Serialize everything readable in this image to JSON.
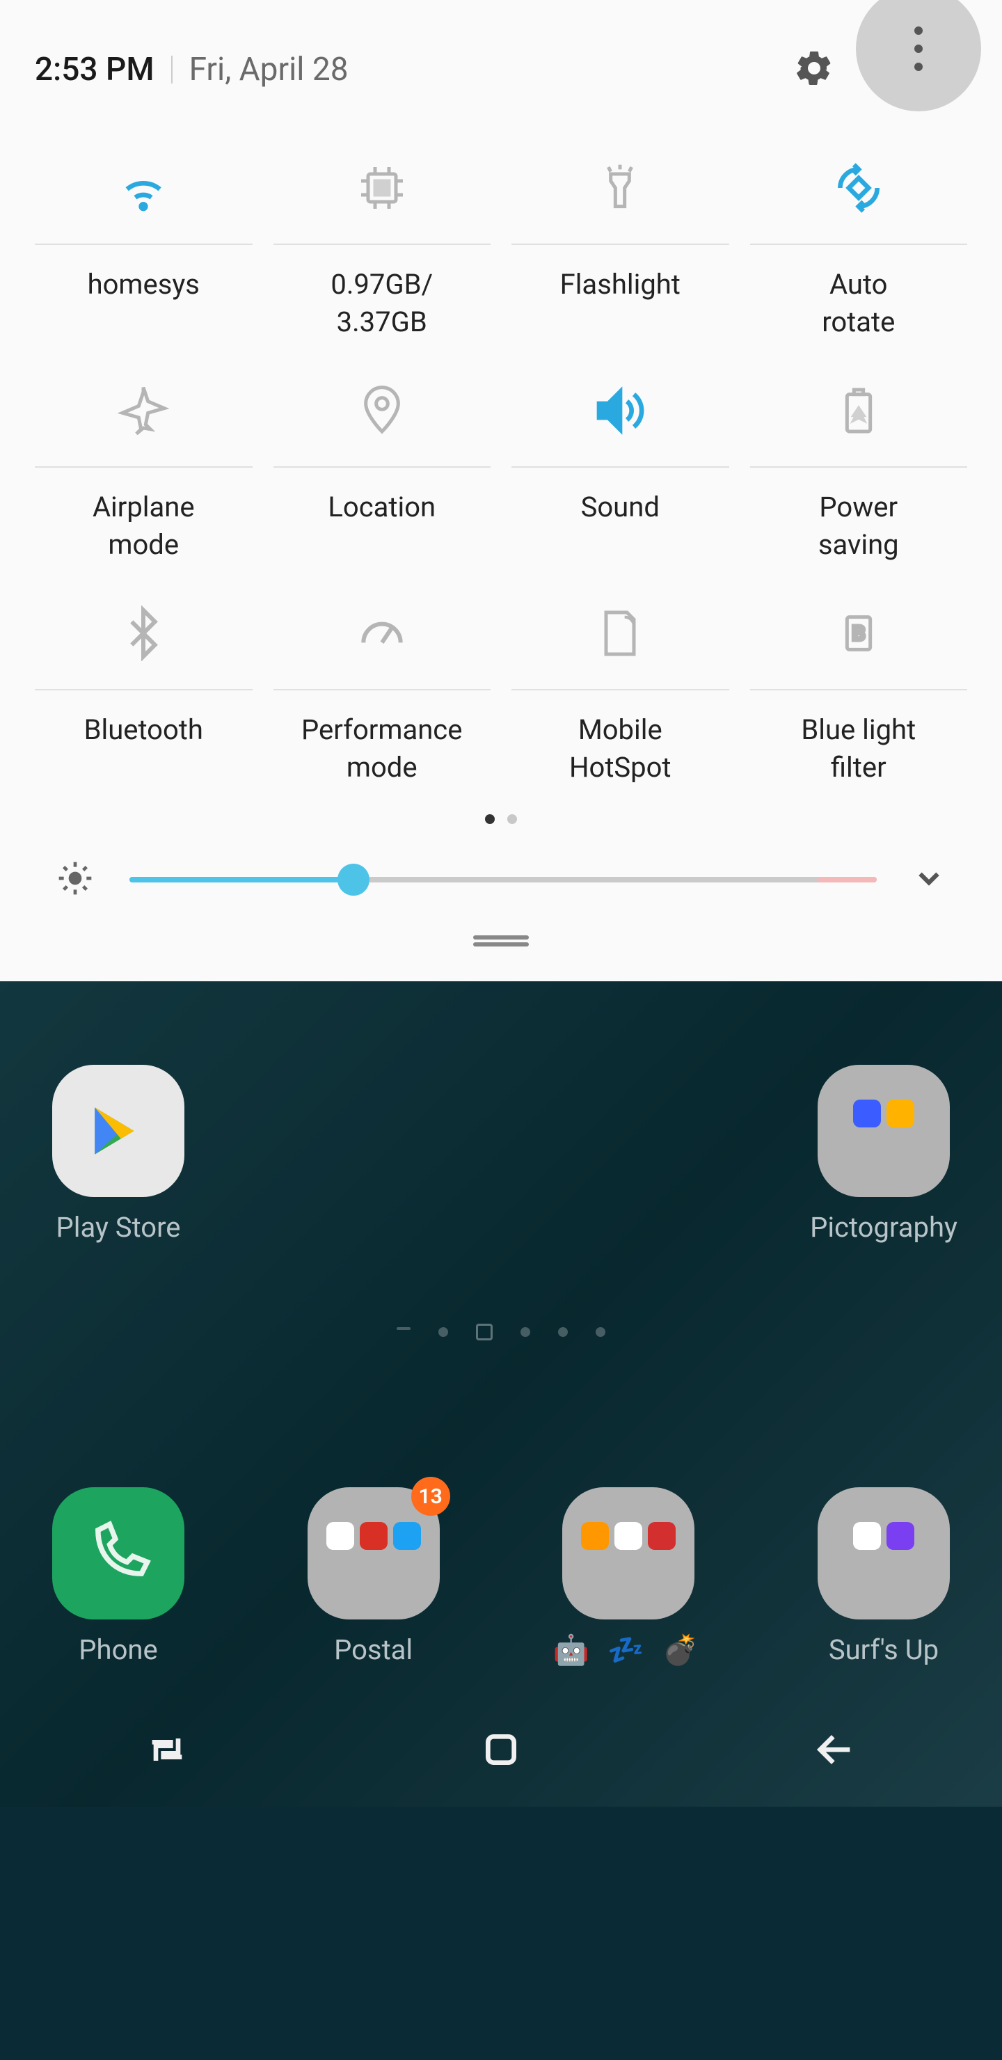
{
  "header": {
    "time": "2:53 PM",
    "date": "Fri, April 28"
  },
  "tiles": [
    {
      "id": "wifi",
      "label": "homesys",
      "active": true
    },
    {
      "id": "ram",
      "label": "0.97GB/\n3.37GB",
      "active": false
    },
    {
      "id": "flashlight",
      "label": "Flashlight",
      "active": false
    },
    {
      "id": "rotate",
      "label": "Auto\nrotate",
      "active": true
    },
    {
      "id": "airplane",
      "label": "Airplane\nmode",
      "active": false
    },
    {
      "id": "location",
      "label": "Location",
      "active": false
    },
    {
      "id": "sound",
      "label": "Sound",
      "active": true
    },
    {
      "id": "power",
      "label": "Power\nsaving",
      "active": false
    },
    {
      "id": "bluetooth",
      "label": "Bluetooth",
      "active": false
    },
    {
      "id": "perf",
      "label": "Performance\nmode",
      "active": false
    },
    {
      "id": "hotspot",
      "label": "Mobile\nHotSpot",
      "active": false
    },
    {
      "id": "bluelight",
      "label": "Blue light\nfilter",
      "active": false
    }
  ],
  "brightness": {
    "percent": 30
  },
  "home": {
    "row1": [
      {
        "id": "playstore",
        "label": "Play Store"
      },
      {
        "id": "pictography",
        "label": "Pictography"
      }
    ],
    "row2": [
      {
        "id": "phone",
        "label": "Phone"
      },
      {
        "id": "postal",
        "label": "Postal",
        "badge": "13"
      },
      {
        "id": "widgets",
        "label": "🤖 💤 💣"
      },
      {
        "id": "surfsup",
        "label": "Surf's Up"
      }
    ]
  }
}
